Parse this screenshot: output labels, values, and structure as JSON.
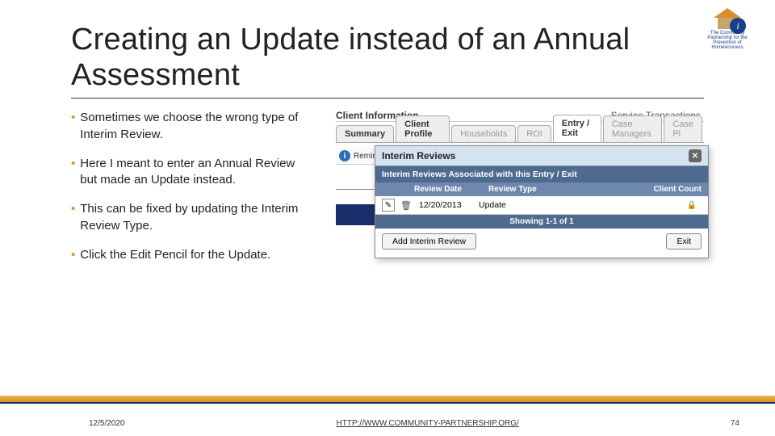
{
  "title": "Creating an Update instead of an Annual Assessment",
  "bullets": [
    "Sometimes we choose the wrong type of Interim Review.",
    "Here I meant to enter an Annual Review but made an Update instead.",
    "This can be fixed by updating the Interim Review Type.",
    "Click the Edit Pencil for the Update."
  ],
  "logo_caption": "The Community Partnership for the Prevention of Homelessness",
  "ci": {
    "heading": "Client Information",
    "svc": "Service Transactions",
    "tabs": [
      "Summary",
      "Client Profile",
      "Households",
      "ROI",
      "Entry / Exit",
      "Case Managers",
      "Case Pl"
    ],
    "reminder": "Reminder: Household members must be established on Households tab before cre"
  },
  "modal": {
    "title": "Interim Reviews",
    "subtitle": "Interim Reviews Associated with this Entry / Exit",
    "cols": {
      "date": "Review Date",
      "type": "Review Type",
      "count": "Client Count"
    },
    "row": {
      "date": "12/20/2013",
      "type": "Update"
    },
    "pager": "Showing 1-1 of 1",
    "add": "Add Interim Review",
    "exit": "Exit"
  },
  "footer": {
    "date": "12/5/2020",
    "link": "HTTP://WWW.COMMUNITY-PARTNERSHIP.ORG/",
    "page": "74"
  }
}
